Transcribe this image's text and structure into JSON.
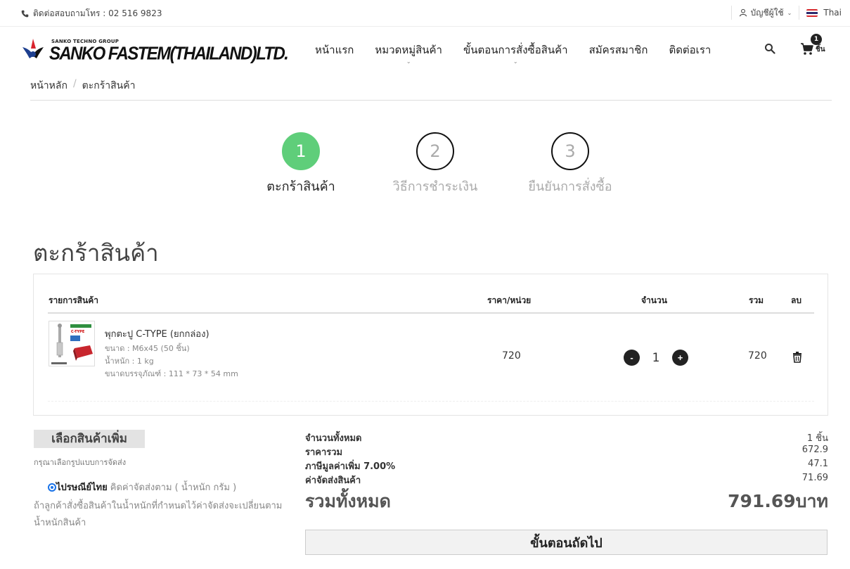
{
  "topbar": {
    "contact": "ติดต่อสอบถามโทร : 02 516 9823",
    "account_label": "บัญชีผู้ใช้",
    "language": "Thai"
  },
  "header": {
    "logo_group": "SANKO TECHNO GROUP",
    "logo_name": "SANKO FASTEM(THAILAND)LTD.",
    "nav": [
      {
        "label": "หน้าแรก"
      },
      {
        "label": "หมวดหมู่สินค้า"
      },
      {
        "label": "ขั้นตอนการสั่งซื้อสินค้า"
      },
      {
        "label": "สมัครสมาชิก"
      },
      {
        "label": "ติดต่อเรา"
      }
    ],
    "cart_count": "1",
    "cart_unit": "ชิ้น"
  },
  "breadcrumb": {
    "home": "หน้าหลัก",
    "current": "ตะกร้าสินค้า"
  },
  "steps": [
    {
      "num": "1",
      "label": "ตะกร้าสินค้า"
    },
    {
      "num": "2",
      "label": "วิธีการชำระเงิน"
    },
    {
      "num": "3",
      "label": "ยืนยันการสั่งซื้อ"
    }
  ],
  "page_title": "ตะกร้าสินค้า",
  "table": {
    "headers": {
      "item": "รายการสินค้า",
      "price": "ราคา/หน่วย",
      "qty": "จำนวน",
      "total": "รวม",
      "delete": "ลบ"
    },
    "rows": [
      {
        "name": "พุกตะปู C-TYPE (ยกกล่อง)",
        "size": "ขนาด : M6x45 (50 ชิ้น)",
        "weight": "น้ำหนัก : 1 kg",
        "package": "ขนาดบรรจุภัณฑ์ : 111 * 73 * 54 mm",
        "price": "720",
        "qty": "1",
        "total": "720",
        "thumb_text": "C-TYPE"
      }
    ],
    "minus": "-",
    "plus": "+"
  },
  "shipping": {
    "more_button": "เลือกสินค้าเพิ่ม",
    "note": "กรุณาเลือกรูปแบบการจัดส่ง",
    "option_name": "ไปรษณีย์ไทย",
    "option_detail": "คิดค่าจัดส่งตาม ( น้ำหนัก กรัม )",
    "warning": "ถ้าลูกค้าสั่งซื้อสินค้าในน้ำหนักที่กำหนดไว้ค่าจัดส่งจะเปลี่ยนตามน้ำหนักสินค้า"
  },
  "summary": {
    "count_label": "จำนวนทั้งหมด",
    "count_value": "1 ชิ้น",
    "subtotal_label": "ราคารวม",
    "subtotal_value": "672.9",
    "vat_label": "ภาษีมูลค่าเพิ่ม 7.00%",
    "vat_value": "47.1",
    "shipping_label": "ค่าจัดส่งสินค้า",
    "shipping_value": "71.69",
    "grand_label": "รวมทั้งหมด",
    "grand_value": "791.69บาท",
    "next_button": "ขั้นตอนถัดไป"
  },
  "colors": {
    "step_active": "#5fce7a",
    "radio": "#1a73e8"
  }
}
